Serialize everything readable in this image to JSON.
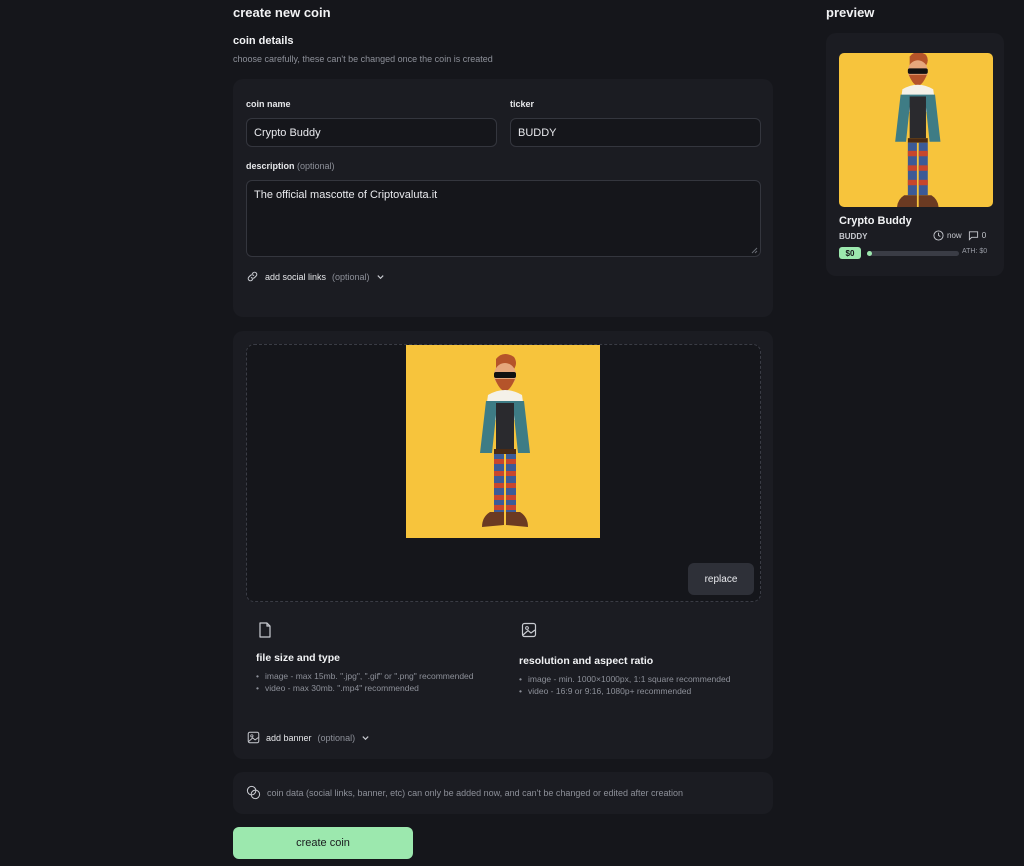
{
  "page": {
    "title": "create new coin",
    "section_title": "coin details",
    "section_subtitle": "choose carefully, these can't be changed once the coin is created"
  },
  "form": {
    "name_label": "coin name",
    "name_value": "Crypto Buddy",
    "ticker_label": "ticker",
    "ticker_value": "BUDDY",
    "description_label": "description",
    "description_optional": "(optional)",
    "description_value": "The official mascotte of Criptovaluta.it",
    "social_links_label": "add social links",
    "social_links_optional": "(optional)"
  },
  "upload": {
    "replace_label": "replace",
    "file_title": "file size and type",
    "file_items": [
      "image - max 15mb. \".jpg\", \".gif\" or \".png\" recommended",
      "video - max 30mb. \".mp4\" recommended"
    ],
    "res_title": "resolution and aspect ratio",
    "res_items": [
      "image - min. 1000×1000px, 1:1 square recommended",
      "video - 16:9 or 9:16, 1080p+ recommended"
    ],
    "banner_label": "add banner",
    "banner_optional": "(optional)"
  },
  "notice": {
    "text": "coin data (social links, banner, etc) can only be added now, and can't be changed or edited after creation"
  },
  "create_button": "create coin",
  "preview": {
    "title": "preview",
    "coin_name": "Crypto Buddy",
    "ticker": "BUDDY",
    "time": "now",
    "comments": "0",
    "market_cap": "$0",
    "ath": "ATH: $0",
    "progress": 0.05
  },
  "colors": {
    "background": "#15161b",
    "card": "#1b1c22",
    "accent_green": "#9ce8ae",
    "image_yellow": "#f7c43c"
  },
  "icons": {
    "link": "link-icon",
    "chevron": "chevron-down-icon",
    "file": "file-icon",
    "image": "image-icon",
    "banner": "banner-image-icon",
    "info": "coins-info-icon",
    "clock": "clock-icon",
    "comment": "comment-icon"
  }
}
